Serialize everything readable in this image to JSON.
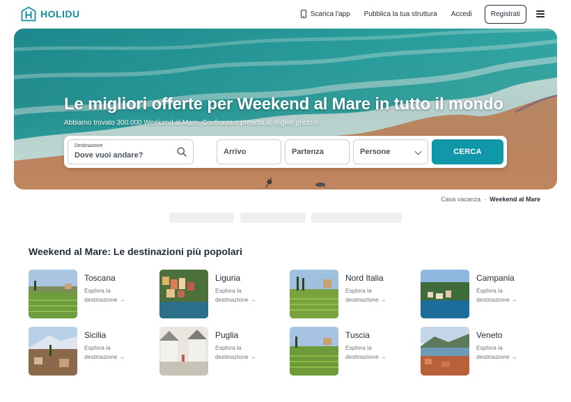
{
  "brand": {
    "name": "HOLIDU",
    "color": "#0e8fa0"
  },
  "nav": {
    "app_label": "Scarica l'app",
    "app_icon": "phone-icon",
    "publish_label": "Pubblica la tua struttura",
    "login_label": "Accedi",
    "register_label": "Registrati",
    "menu_icon": "hamburger-menu-icon"
  },
  "hero": {
    "title": "Le migliori offerte per Weekend al Mare in tutto il mondo",
    "subtitle": "Abbiamo trovato 300.000 Weekend al Mare. Confronta e prenota al miglior prezzo!"
  },
  "search": {
    "destination_label": "Destinazione",
    "destination_placeholder": "Dove vuoi andare?",
    "checkin_label": "Arrivo",
    "checkout_label": "Partenza",
    "guests_label": "Persone",
    "submit_label": "CERCA",
    "accent": "#1098a8"
  },
  "breadcrumb": {
    "parent": "Casa vacanza",
    "separator": "·",
    "current": "Weekend al Mare"
  },
  "section": {
    "title": "Weekend al Mare: Le destinazioni più popolari",
    "explore_label": "Esplora la destinazione →",
    "destinations": [
      {
        "name": "Toscana"
      },
      {
        "name": "Liguria"
      },
      {
        "name": "Nord Italia"
      },
      {
        "name": "Campania"
      },
      {
        "name": "Sicilia"
      },
      {
        "name": "Puglia"
      },
      {
        "name": "Tuscia"
      },
      {
        "name": "Veneto"
      }
    ]
  }
}
